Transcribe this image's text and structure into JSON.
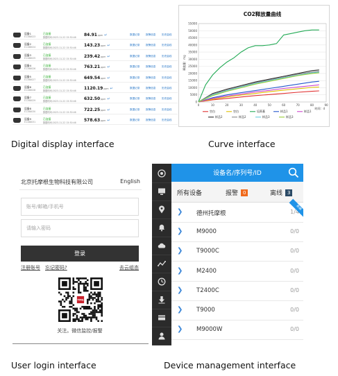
{
  "captions": {
    "digital": "Digital display interface",
    "curve": "Curve interface",
    "login": "User login interface",
    "device": "Device management interface"
  },
  "digital_display": {
    "rows": [
      {
        "name": "设备1",
        "serial": "E1168023",
        "status": "已连接",
        "time": "数据时间:2023-11-22 15:30:46",
        "value": "84.91",
        "unit": "ppm",
        "links": [
          "数据记录",
          "报警信息",
          "历史曲线"
        ]
      },
      {
        "name": "设备2",
        "serial": "E1168024",
        "status": "已连接",
        "time": "数据时间:2023-11-22 15:30:46",
        "value": "143.23",
        "unit": "ppm",
        "links": [
          "数据记录",
          "报警信息",
          "历史曲线"
        ]
      },
      {
        "name": "设备3",
        "serial": "E1168025",
        "status": "已连接",
        "time": "数据时间:2023-11-22 15:30:46",
        "value": "239.42",
        "unit": "ppm",
        "links": [
          "数据记录",
          "报警信息",
          "历史曲线"
        ]
      },
      {
        "name": "设备4",
        "serial": "E1168026",
        "status": "已连接",
        "time": "数据时间:2023-11-22 15:30:46",
        "value": "763.21",
        "unit": "ppm",
        "links": [
          "数据记录",
          "报警信息",
          "历史曲线"
        ]
      },
      {
        "name": "设备5",
        "serial": "E1168027",
        "status": "已连接",
        "time": "数据时间:2023-11-22 15:30:46",
        "value": "649.54",
        "unit": "ppm",
        "links": [
          "数据记录",
          "报警信息",
          "历史曲线"
        ]
      },
      {
        "name": "设备6",
        "serial": "E1168028",
        "status": "已连接",
        "time": "数据时间:2023-11-22 15:30:46",
        "value": "1120.19",
        "unit": "ppm",
        "links": [
          "数据记录",
          "报警信息",
          "历史曲线"
        ]
      },
      {
        "name": "设备7",
        "serial": "E1168029",
        "status": "已连接",
        "time": "数据时间:2023-11-22 15:30:46",
        "value": "632.50",
        "unit": "ppm",
        "links": [
          "数据记录",
          "报警信息",
          "历史曲线"
        ]
      },
      {
        "name": "设备8",
        "serial": "E1168030",
        "status": "已连接",
        "time": "数据时间:2023-11-22 15:30:46",
        "value": "722.25",
        "unit": "ppm",
        "links": [
          "数据记录",
          "报警信息",
          "历史曲线"
        ]
      },
      {
        "name": "设备9",
        "serial": "E1168031",
        "status": "已连接",
        "time": "数据时间:2023-11-22 15:30:46",
        "value": "578.63",
        "unit": "ppm",
        "links": [
          "数据记录",
          "报警信息",
          "历史曲线"
        ]
      }
    ],
    "arrow": "↵"
  },
  "chart_data": {
    "type": "line",
    "title": "CO2释放量曲线",
    "xlabel": "时间：d",
    "ylabel": "释放量：mg",
    "xlim": [
      0,
      90
    ],
    "ylim": [
      0,
      55000
    ],
    "xticks": [
      0,
      10,
      20,
      30,
      40,
      50,
      60,
      70,
      80,
      90
    ],
    "yticks": [
      0,
      5000,
      10000,
      15000,
      20000,
      25000,
      30000,
      35000,
      40000,
      45000,
      50000,
      55000
    ],
    "legend_position": "bottom",
    "series": [
      {
        "name": "空白",
        "color": "#e03030",
        "x": [
          0,
          10,
          20,
          30,
          40,
          50,
          60,
          70,
          80,
          85
        ],
        "y": [
          0,
          1500,
          2500,
          3500,
          4500,
          5200,
          6000,
          6800,
          7500,
          7800
        ]
      },
      {
        "name": "空白",
        "color": "#e0c000",
        "x": [
          0,
          10,
          20,
          30,
          40,
          50,
          60,
          70,
          80,
          85
        ],
        "y": [
          0,
          2000,
          3500,
          4800,
          6000,
          7200,
          8300,
          9300,
          10200,
          10500
        ]
      },
      {
        "name": "培养基",
        "color": "#22aa55",
        "x": [
          0,
          5,
          10,
          15,
          20,
          25,
          30,
          35,
          40,
          45,
          50,
          55,
          60,
          65,
          70,
          75,
          80,
          85
        ],
        "y": [
          0,
          12000,
          19000,
          24000,
          28000,
          31000,
          35000,
          38000,
          39500,
          39500,
          40000,
          41000,
          47000,
          48000,
          49000,
          50000,
          50500,
          50500
        ]
      },
      {
        "name": "样品1",
        "color": "#2255cc",
        "x": [
          0,
          10,
          20,
          30,
          40,
          50,
          60,
          70,
          80,
          85
        ],
        "y": [
          0,
          3000,
          5000,
          6500,
          8000,
          9500,
          11000,
          12500,
          14000,
          14500
        ]
      },
      {
        "name": "样品1",
        "color": "#cc44cc",
        "x": [
          0,
          10,
          20,
          30,
          40,
          50,
          60,
          70,
          80,
          85
        ],
        "y": [
          0,
          2500,
          4200,
          5500,
          7000,
          8200,
          9500,
          10500,
          11500,
          12000
        ]
      },
      {
        "name": "样品2",
        "color": "#2a2a2a",
        "x": [
          0,
          10,
          20,
          30,
          40,
          50,
          60,
          70,
          80,
          85
        ],
        "y": [
          0,
          6000,
          9000,
          11500,
          14000,
          16000,
          18000,
          20000,
          22000,
          22500
        ]
      },
      {
        "name": "样品2",
        "color": "#888888",
        "x": [
          0,
          10,
          20,
          30,
          40,
          50,
          60,
          70,
          80,
          85
        ],
        "y": [
          0,
          5500,
          8500,
          11000,
          13500,
          15500,
          17500,
          19500,
          21000,
          21500
        ]
      },
      {
        "name": "样品3",
        "color": "#66ccdd",
        "x": [
          0,
          10,
          20,
          30,
          40,
          50,
          60,
          70,
          80,
          85
        ],
        "y": [
          0,
          5000,
          8000,
          10500,
          13000,
          15000,
          17000,
          18800,
          20500,
          21000
        ]
      },
      {
        "name": "样品3",
        "color": "#99cc33",
        "x": [
          0,
          10,
          20,
          30,
          40,
          50,
          60,
          70,
          80,
          85
        ],
        "y": [
          0,
          4500,
          7500,
          10000,
          12500,
          14500,
          16500,
          18500,
          20000,
          20500
        ]
      }
    ]
  },
  "login": {
    "company": "北京托摩根生物科技有限公司",
    "language": "English",
    "account_placeholder": "账号/邮箱/手机号",
    "password_placeholder": "请输入密码",
    "login_button": "登录",
    "register_link": "注册账号",
    "forgot_link": "忘记密码?",
    "cloud_link": "去云组态",
    "qr_center_text": "TMG",
    "follow_text": "关注。微信监控/报警"
  },
  "device_mgmt": {
    "header_title": "设备名/序列号/ID",
    "tabs": [
      {
        "label": "所有设备",
        "count": "",
        "color": ""
      },
      {
        "label": "报警",
        "count": "0",
        "color": "#f06a1c"
      },
      {
        "label": "离线",
        "count": "3",
        "color": "#2b4a66"
      }
    ],
    "ribbon": "新装",
    "sidebar_icons": [
      "target-icon",
      "monitor-icon",
      "location-icon",
      "bell-icon",
      "cloud-icon",
      "chart-icon",
      "clock-icon",
      "download-icon",
      "card-icon",
      "user-icon"
    ],
    "devices": [
      {
        "name": "德州托摩根",
        "count": "1/4"
      },
      {
        "name": "M9000",
        "count": "0/0"
      },
      {
        "name": "T9000C",
        "count": "0/0"
      },
      {
        "name": "M2400",
        "count": "0/0"
      },
      {
        "name": "T2400C",
        "count": "0/0"
      },
      {
        "name": "T9000",
        "count": "0/0"
      },
      {
        "name": "M9000W",
        "count": "0/0"
      }
    ]
  }
}
